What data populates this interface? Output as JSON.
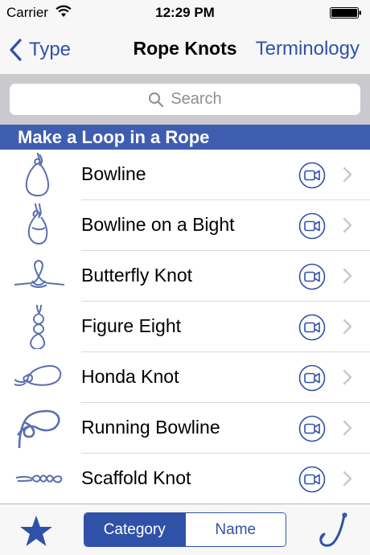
{
  "status_bar": {
    "carrier": "Carrier",
    "time": "12:29 PM"
  },
  "nav": {
    "back_label": "Type",
    "title": "Rope Knots",
    "right_label": "Terminology"
  },
  "search": {
    "placeholder": "Search"
  },
  "section": {
    "title": "Make a Loop in a Rope"
  },
  "knots": [
    {
      "name": "Bowline"
    },
    {
      "name": "Bowline on a Bight"
    },
    {
      "name": "Butterfly Knot"
    },
    {
      "name": "Figure Eight"
    },
    {
      "name": "Honda Knot"
    },
    {
      "name": "Running Bowline"
    },
    {
      "name": "Scaffold Knot"
    }
  ],
  "toolbar": {
    "segments": [
      "Category",
      "Name"
    ],
    "selected_segment": "Category"
  },
  "colors": {
    "accent": "#2f52a8",
    "section_bg": "#3f5db0",
    "rope": "#5b6fb0"
  },
  "icons": [
    "wifi-icon",
    "battery-icon",
    "back-chevron-icon",
    "search-icon",
    "knot-thumbnail",
    "video-icon",
    "chevron-right-icon",
    "star-icon",
    "fishhook-icon"
  ]
}
